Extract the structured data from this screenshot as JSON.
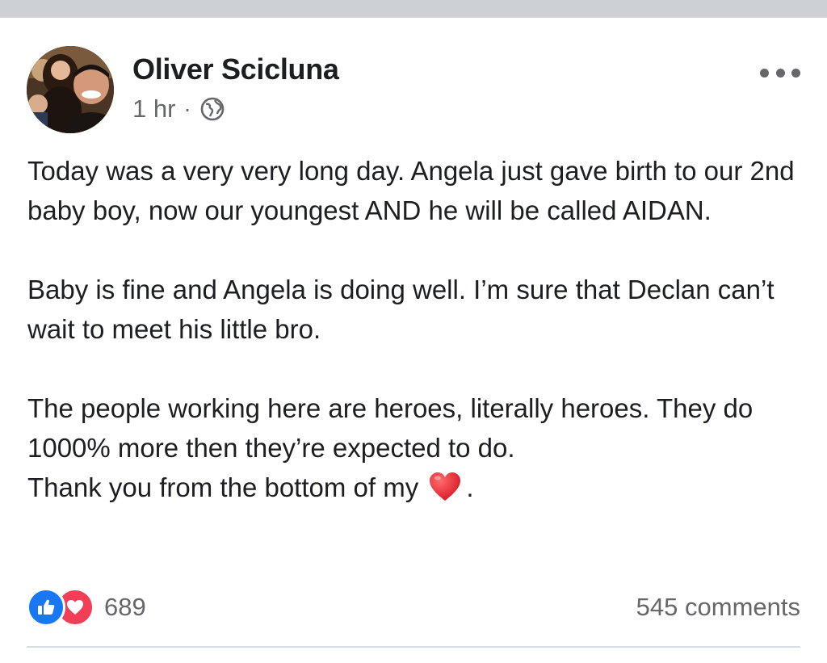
{
  "post": {
    "author": "Oliver Scicluna",
    "time": "1 hr",
    "separator": "·",
    "privacy_icon": "globe-icon",
    "menu_icon": "more-options-icon",
    "paragraphs": [
      "Today was a very very long day. Angela just gave birth to our 2nd baby boy, now our youngest AND he will be called AIDAN.",
      "Baby is fine and Angela is doing well. I’m sure that Declan can’t wait to meet his little bro.",
      "The people working here are heroes, literally heroes. They do 1000% more then they’re expected to do."
    ],
    "closing_line": {
      "before_emoji": "Thank you from the bottom of my",
      "emoji": "red-heart-emoji",
      "after_emoji": "."
    }
  },
  "footer": {
    "reaction_icons": [
      "like-icon",
      "love-icon"
    ],
    "reaction_count": "689",
    "comments": "545 comments"
  },
  "colors": {
    "top_strip": "#cdd0d4",
    "secondary_text": "#65676b",
    "like_blue": "#1877f2",
    "love_red": "#f33e58",
    "heart_red": "#e0202f",
    "divider": "#dadde1"
  }
}
